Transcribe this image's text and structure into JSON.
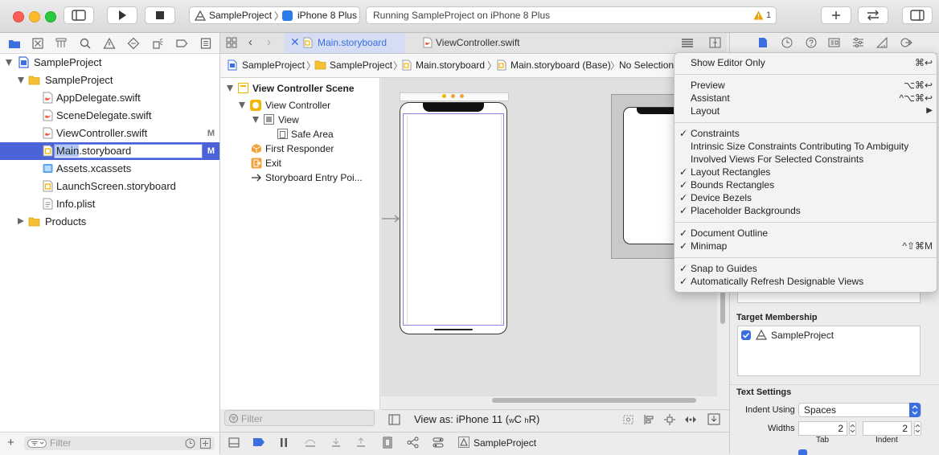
{
  "colors": {
    "accent": "#3b6fe0",
    "selection": "#4c63d8",
    "warning": "#e8a300",
    "storyboard_yellow": "#f2b500"
  },
  "toolbar": {
    "scheme_project": "SampleProject",
    "scheme_device": "iPhone 8 Plus",
    "status_text": "Running SampleProject on iPhone 8 Plus",
    "warning_count": "1",
    "add_icon": "plus-icon",
    "swap_icon": "two-arrows-icon"
  },
  "navigator": {
    "root": "SampleProject",
    "group": "SampleProject",
    "files": [
      {
        "name": "AppDelegate.swift",
        "mark": ""
      },
      {
        "name": "SceneDelegate.swift",
        "mark": ""
      },
      {
        "name": "ViewController.swift",
        "mark": "M"
      },
      {
        "name": "Main.storyboard",
        "mark": "M"
      },
      {
        "name": "Assets.xcassets",
        "mark": ""
      },
      {
        "name": "LaunchScreen.storyboard",
        "mark": ""
      },
      {
        "name": "Info.plist",
        "mark": ""
      }
    ],
    "rename_selected": "Main",
    "rename_rest": ".storyboard",
    "products": "Products",
    "filter_placeholder": "Filter"
  },
  "tabs": [
    {
      "label": "Main.storyboard",
      "active": true
    },
    {
      "label": "ViewController.swift",
      "active": false
    }
  ],
  "jumpbar": [
    "SampleProject",
    "SampleProject",
    "Main.storyboard",
    "Main.storyboard (Base)",
    "No Selection"
  ],
  "outline": {
    "scene": "View Controller Scene",
    "view_controller": "View Controller",
    "view": "View",
    "safe_area": "Safe Area",
    "first_responder": "First Responder",
    "exit": "Exit",
    "entry_point": "Storyboard Entry Poi...",
    "filter_placeholder": "Filter"
  },
  "canvas_footer": {
    "view_as": "View as: iPhone 11 (",
    "size_w": "w",
    "size_c": "C ",
    "size_h": "h",
    "size_r": "R)"
  },
  "inspector": {
    "target_membership": "Target Membership",
    "target_name": "SampleProject",
    "text_settings": "Text Settings",
    "indent_using_label": "Indent Using",
    "indent_using_value": "Spaces",
    "widths_label": "Widths",
    "tab_value": "2",
    "indent_value": "2",
    "tab_label": "Tab",
    "indent_label": "Indent"
  },
  "bottom_bar": {
    "target": "SampleProject"
  },
  "menu": {
    "groups": [
      [
        {
          "label": "Show Editor Only",
          "shortcut": "⌘↩",
          "checked": false
        }
      ],
      [
        {
          "label": "Preview",
          "shortcut": "⌥⌘↩",
          "checked": false
        },
        {
          "label": "Assistant",
          "shortcut": "^⌥⌘↩",
          "checked": false
        },
        {
          "label": "Layout",
          "shortcut": "▶",
          "checked": false
        }
      ],
      [
        {
          "label": "Constraints",
          "shortcut": "",
          "checked": true
        },
        {
          "label": "Intrinsic Size Constraints Contributing To Ambiguity",
          "shortcut": "",
          "checked": false
        },
        {
          "label": "Involved Views For Selected Constraints",
          "shortcut": "",
          "checked": false
        },
        {
          "label": "Layout Rectangles",
          "shortcut": "",
          "checked": true
        },
        {
          "label": "Bounds Rectangles",
          "shortcut": "",
          "checked": true
        },
        {
          "label": "Device Bezels",
          "shortcut": "",
          "checked": true
        },
        {
          "label": "Placeholder Backgrounds",
          "shortcut": "",
          "checked": true
        }
      ],
      [
        {
          "label": "Document Outline",
          "shortcut": "",
          "checked": true
        },
        {
          "label": "Minimap",
          "shortcut": "^⇧⌘M",
          "checked": true
        }
      ],
      [
        {
          "label": "Snap to Guides",
          "shortcut": "",
          "checked": true
        },
        {
          "label": "Automatically Refresh Designable Views",
          "shortcut": "",
          "checked": true
        }
      ]
    ]
  }
}
